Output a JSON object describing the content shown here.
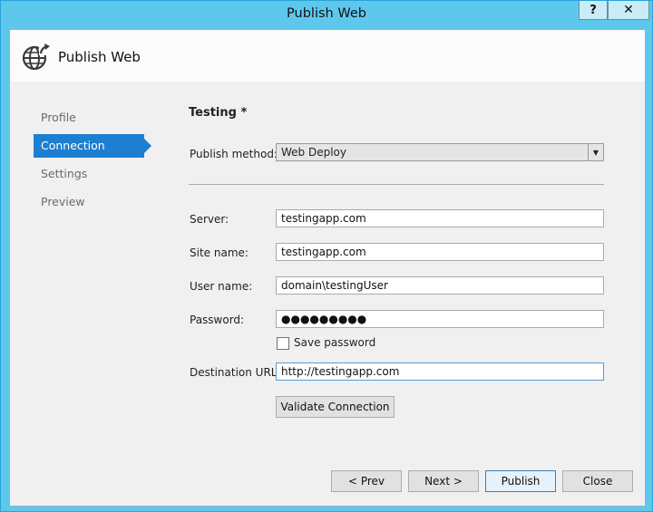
{
  "window": {
    "title": "Publish Web",
    "help_label": "?",
    "close_label": "✕"
  },
  "header": {
    "title": "Publish Web",
    "icon": "globe-publish-icon"
  },
  "nav": {
    "items": [
      {
        "label": "Profile",
        "active": false
      },
      {
        "label": "Connection",
        "active": true
      },
      {
        "label": "Settings",
        "active": false
      },
      {
        "label": "Preview",
        "active": false
      }
    ]
  },
  "form": {
    "profile_name": "Testing *",
    "publish_method_label": "Publish method:",
    "publish_method_value": "Web Deploy",
    "server_label": "Server:",
    "server_value": "testingapp.com",
    "site_name_label": "Site name:",
    "site_name_value": "testingapp.com",
    "user_name_label": "User name:",
    "user_name_value": "domain\\testingUser",
    "password_label": "Password:",
    "password_value": "●●●●●●●●●",
    "save_password_label": "Save password",
    "save_password_checked": false,
    "destination_url_label": "Destination URL:",
    "destination_url_value": "http://testingapp.com",
    "validate_label": "Validate Connection"
  },
  "footer": {
    "prev_label": "< Prev",
    "next_label": "Next >",
    "publish_label": "Publish",
    "close_label": "Close"
  },
  "colors": {
    "titlebar": "#5ec8ec",
    "nav_active": "#1c7fd0"
  }
}
